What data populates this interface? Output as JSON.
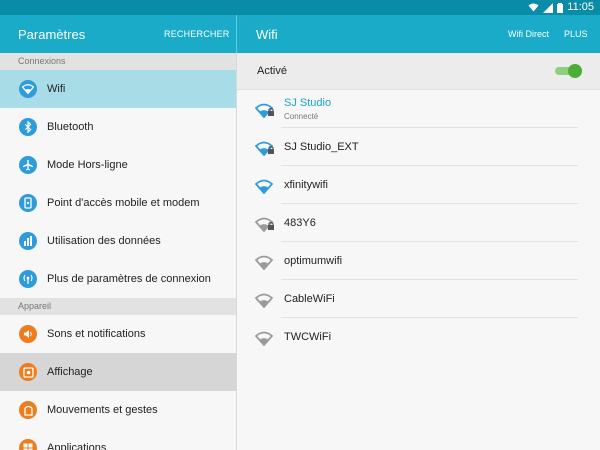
{
  "status_bar": {
    "time": "11:05",
    "icons": [
      "wifi-icon",
      "signal-icon",
      "battery-icon"
    ]
  },
  "left_header": {
    "title": "Paramètres",
    "search": "RECHERCHER"
  },
  "right_header": {
    "title": "Wifi",
    "wifi_direct": "Wifi Direct",
    "more": "PLUS"
  },
  "sidebar": {
    "sections": [
      {
        "label": "Connexions"
      },
      {
        "label": "Appareil"
      }
    ],
    "items": [
      {
        "label": "Wifi",
        "icon": "wifi-icon",
        "color": "#2e9bdb"
      },
      {
        "label": "Bluetooth",
        "icon": "bluetooth-icon",
        "color": "#2e9bdb"
      },
      {
        "label": "Mode Hors-ligne",
        "icon": "airplane-icon",
        "color": "#2e9bdb"
      },
      {
        "label": "Point d'accès mobile et modem",
        "icon": "hotspot-icon",
        "color": "#2e9bdb"
      },
      {
        "label": "Utilisation des données",
        "icon": "data-usage-icon",
        "color": "#2e9bdb"
      },
      {
        "label": "Plus de paramètres de connexion",
        "icon": "connection-settings-icon",
        "color": "#2e9bdb"
      },
      {
        "label": "Sons et notifications",
        "icon": "sound-icon",
        "color": "#ee7d1d"
      },
      {
        "label": "Affichage",
        "icon": "display-icon",
        "color": "#ee7d1d"
      },
      {
        "label": "Mouvements et gestes",
        "icon": "motion-icon",
        "color": "#ee7d1d"
      },
      {
        "label": "Applications",
        "icon": "apps-icon",
        "color": "#ee7d1d"
      }
    ]
  },
  "wifi": {
    "toggle_label": "Activé",
    "enabled": true,
    "networks": [
      {
        "name": "SJ Studio",
        "status": "Connecté",
        "secured": true
      },
      {
        "name": "SJ Studio_EXT",
        "secured": true
      },
      {
        "name": "xfinitywifi",
        "secured": false
      },
      {
        "name": "483Y6",
        "secured": true
      },
      {
        "name": "optimumwifi",
        "secured": false
      },
      {
        "name": "CableWiFi",
        "secured": false
      },
      {
        "name": "TWCWiFi",
        "secured": false
      }
    ]
  },
  "colors": {
    "accent": "#1aabc9",
    "statusbar": "#0a8ca8",
    "selected": "#a8dde8",
    "toggle_on": "#4cae37"
  }
}
